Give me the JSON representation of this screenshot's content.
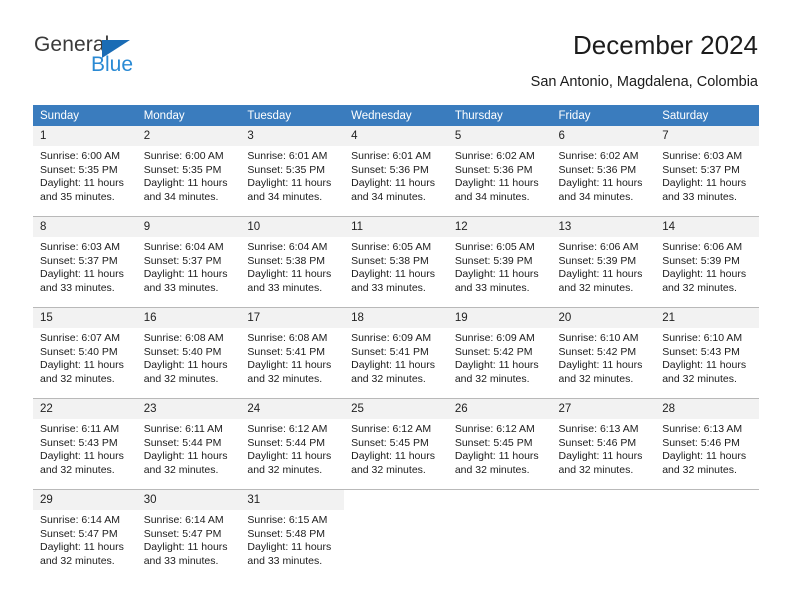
{
  "brand": {
    "name_top": "General",
    "name_bottom": "Blue",
    "colors": {
      "top": "#3a3a3a",
      "bottom": "#2a8ad4",
      "triangle": "#1a6cb5"
    }
  },
  "header": {
    "title": "December 2024",
    "subtitle": "San Antonio, Magdalena, Colombia"
  },
  "calendar": {
    "header_bg": "#3a7cbe",
    "daynum_bg": "#f2f2f2",
    "weekdays": [
      "Sunday",
      "Monday",
      "Tuesday",
      "Wednesday",
      "Thursday",
      "Friday",
      "Saturday"
    ],
    "weeks": [
      [
        {
          "day": "1",
          "sunrise": "Sunrise: 6:00 AM",
          "sunset": "Sunset: 5:35 PM",
          "daylight1": "Daylight: 11 hours",
          "daylight2": "and 35 minutes."
        },
        {
          "day": "2",
          "sunrise": "Sunrise: 6:00 AM",
          "sunset": "Sunset: 5:35 PM",
          "daylight1": "Daylight: 11 hours",
          "daylight2": "and 34 minutes."
        },
        {
          "day": "3",
          "sunrise": "Sunrise: 6:01 AM",
          "sunset": "Sunset: 5:35 PM",
          "daylight1": "Daylight: 11 hours",
          "daylight2": "and 34 minutes."
        },
        {
          "day": "4",
          "sunrise": "Sunrise: 6:01 AM",
          "sunset": "Sunset: 5:36 PM",
          "daylight1": "Daylight: 11 hours",
          "daylight2": "and 34 minutes."
        },
        {
          "day": "5",
          "sunrise": "Sunrise: 6:02 AM",
          "sunset": "Sunset: 5:36 PM",
          "daylight1": "Daylight: 11 hours",
          "daylight2": "and 34 minutes."
        },
        {
          "day": "6",
          "sunrise": "Sunrise: 6:02 AM",
          "sunset": "Sunset: 5:36 PM",
          "daylight1": "Daylight: 11 hours",
          "daylight2": "and 34 minutes."
        },
        {
          "day": "7",
          "sunrise": "Sunrise: 6:03 AM",
          "sunset": "Sunset: 5:37 PM",
          "daylight1": "Daylight: 11 hours",
          "daylight2": "and 33 minutes."
        }
      ],
      [
        {
          "day": "8",
          "sunrise": "Sunrise: 6:03 AM",
          "sunset": "Sunset: 5:37 PM",
          "daylight1": "Daylight: 11 hours",
          "daylight2": "and 33 minutes."
        },
        {
          "day": "9",
          "sunrise": "Sunrise: 6:04 AM",
          "sunset": "Sunset: 5:37 PM",
          "daylight1": "Daylight: 11 hours",
          "daylight2": "and 33 minutes."
        },
        {
          "day": "10",
          "sunrise": "Sunrise: 6:04 AM",
          "sunset": "Sunset: 5:38 PM",
          "daylight1": "Daylight: 11 hours",
          "daylight2": "and 33 minutes."
        },
        {
          "day": "11",
          "sunrise": "Sunrise: 6:05 AM",
          "sunset": "Sunset: 5:38 PM",
          "daylight1": "Daylight: 11 hours",
          "daylight2": "and 33 minutes."
        },
        {
          "day": "12",
          "sunrise": "Sunrise: 6:05 AM",
          "sunset": "Sunset: 5:39 PM",
          "daylight1": "Daylight: 11 hours",
          "daylight2": "and 33 minutes."
        },
        {
          "day": "13",
          "sunrise": "Sunrise: 6:06 AM",
          "sunset": "Sunset: 5:39 PM",
          "daylight1": "Daylight: 11 hours",
          "daylight2": "and 32 minutes."
        },
        {
          "day": "14",
          "sunrise": "Sunrise: 6:06 AM",
          "sunset": "Sunset: 5:39 PM",
          "daylight1": "Daylight: 11 hours",
          "daylight2": "and 32 minutes."
        }
      ],
      [
        {
          "day": "15",
          "sunrise": "Sunrise: 6:07 AM",
          "sunset": "Sunset: 5:40 PM",
          "daylight1": "Daylight: 11 hours",
          "daylight2": "and 32 minutes."
        },
        {
          "day": "16",
          "sunrise": "Sunrise: 6:08 AM",
          "sunset": "Sunset: 5:40 PM",
          "daylight1": "Daylight: 11 hours",
          "daylight2": "and 32 minutes."
        },
        {
          "day": "17",
          "sunrise": "Sunrise: 6:08 AM",
          "sunset": "Sunset: 5:41 PM",
          "daylight1": "Daylight: 11 hours",
          "daylight2": "and 32 minutes."
        },
        {
          "day": "18",
          "sunrise": "Sunrise: 6:09 AM",
          "sunset": "Sunset: 5:41 PM",
          "daylight1": "Daylight: 11 hours",
          "daylight2": "and 32 minutes."
        },
        {
          "day": "19",
          "sunrise": "Sunrise: 6:09 AM",
          "sunset": "Sunset: 5:42 PM",
          "daylight1": "Daylight: 11 hours",
          "daylight2": "and 32 minutes."
        },
        {
          "day": "20",
          "sunrise": "Sunrise: 6:10 AM",
          "sunset": "Sunset: 5:42 PM",
          "daylight1": "Daylight: 11 hours",
          "daylight2": "and 32 minutes."
        },
        {
          "day": "21",
          "sunrise": "Sunrise: 6:10 AM",
          "sunset": "Sunset: 5:43 PM",
          "daylight1": "Daylight: 11 hours",
          "daylight2": "and 32 minutes."
        }
      ],
      [
        {
          "day": "22",
          "sunrise": "Sunrise: 6:11 AM",
          "sunset": "Sunset: 5:43 PM",
          "daylight1": "Daylight: 11 hours",
          "daylight2": "and 32 minutes."
        },
        {
          "day": "23",
          "sunrise": "Sunrise: 6:11 AM",
          "sunset": "Sunset: 5:44 PM",
          "daylight1": "Daylight: 11 hours",
          "daylight2": "and 32 minutes."
        },
        {
          "day": "24",
          "sunrise": "Sunrise: 6:12 AM",
          "sunset": "Sunset: 5:44 PM",
          "daylight1": "Daylight: 11 hours",
          "daylight2": "and 32 minutes."
        },
        {
          "day": "25",
          "sunrise": "Sunrise: 6:12 AM",
          "sunset": "Sunset: 5:45 PM",
          "daylight1": "Daylight: 11 hours",
          "daylight2": "and 32 minutes."
        },
        {
          "day": "26",
          "sunrise": "Sunrise: 6:12 AM",
          "sunset": "Sunset: 5:45 PM",
          "daylight1": "Daylight: 11 hours",
          "daylight2": "and 32 minutes."
        },
        {
          "day": "27",
          "sunrise": "Sunrise: 6:13 AM",
          "sunset": "Sunset: 5:46 PM",
          "daylight1": "Daylight: 11 hours",
          "daylight2": "and 32 minutes."
        },
        {
          "day": "28",
          "sunrise": "Sunrise: 6:13 AM",
          "sunset": "Sunset: 5:46 PM",
          "daylight1": "Daylight: 11 hours",
          "daylight2": "and 32 minutes."
        }
      ],
      [
        {
          "day": "29",
          "sunrise": "Sunrise: 6:14 AM",
          "sunset": "Sunset: 5:47 PM",
          "daylight1": "Daylight: 11 hours",
          "daylight2": "and 32 minutes."
        },
        {
          "day": "30",
          "sunrise": "Sunrise: 6:14 AM",
          "sunset": "Sunset: 5:47 PM",
          "daylight1": "Daylight: 11 hours",
          "daylight2": "and 33 minutes."
        },
        {
          "day": "31",
          "sunrise": "Sunrise: 6:15 AM",
          "sunset": "Sunset: 5:48 PM",
          "daylight1": "Daylight: 11 hours",
          "daylight2": "and 33 minutes."
        },
        {
          "day": "",
          "sunrise": "",
          "sunset": "",
          "daylight1": "",
          "daylight2": ""
        },
        {
          "day": "",
          "sunrise": "",
          "sunset": "",
          "daylight1": "",
          "daylight2": ""
        },
        {
          "day": "",
          "sunrise": "",
          "sunset": "",
          "daylight1": "",
          "daylight2": ""
        },
        {
          "day": "",
          "sunrise": "",
          "sunset": "",
          "daylight1": "",
          "daylight2": ""
        }
      ]
    ]
  }
}
